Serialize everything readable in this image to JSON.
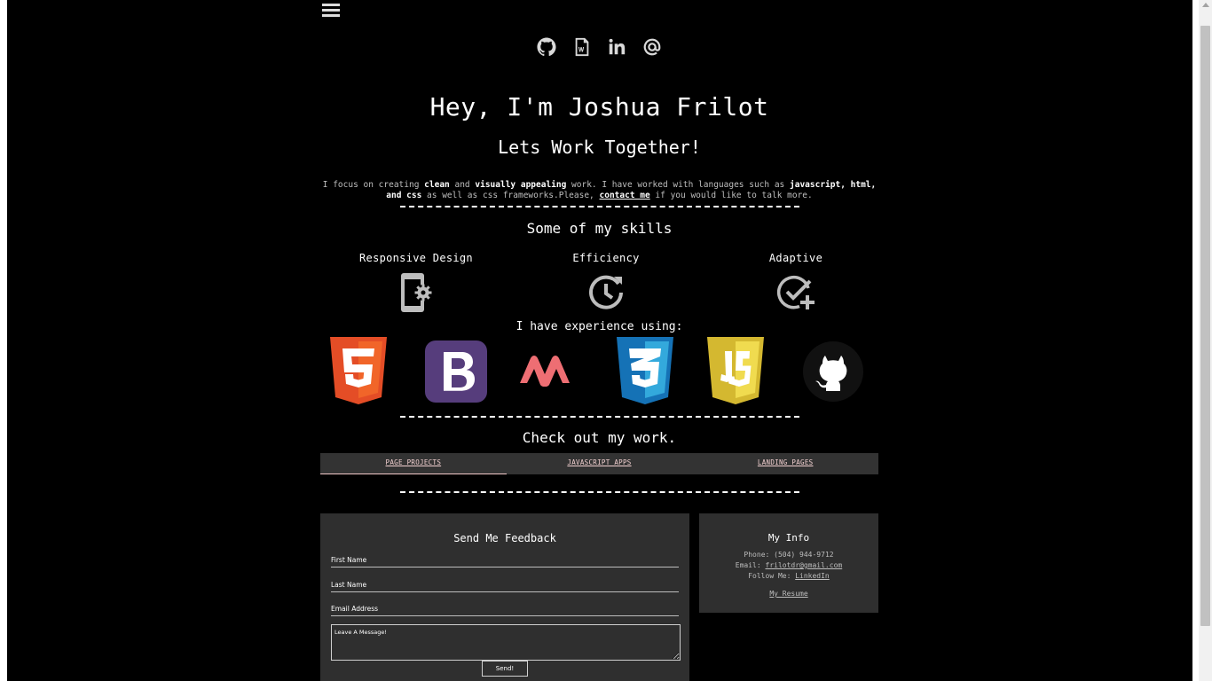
{
  "social": {
    "icons": [
      "github-icon",
      "resume-document-icon",
      "linkedin-icon",
      "email-at-icon"
    ]
  },
  "hero": {
    "title": "Hey, I'm Joshua Frilot",
    "subtitle": "Lets Work Together!"
  },
  "intro": {
    "t1": "I focus on creating ",
    "b1": "clean",
    "t2": " and ",
    "b2": "visually appealing",
    "t3": " work. I have worked with languages such as ",
    "b3": "javascript, html, and css",
    "t4": " as well as css frameworks.Please, ",
    "link": "contact me",
    "t5": " if you would like to talk more."
  },
  "skills": {
    "title": "Some of my skills",
    "items": [
      {
        "label": "Responsive Design",
        "icon": "phone-settings-icon"
      },
      {
        "label": "Efficiency",
        "icon": "clock-refresh-icon"
      },
      {
        "label": "Adaptive",
        "icon": "check-circle-plus-icon"
      }
    ]
  },
  "experience": {
    "title": "I have experience using:",
    "icons": [
      "html5-icon",
      "bootstrap-icon",
      "materialize-icon",
      "css3-icon",
      "javascript-icon",
      "github-octocat-icon"
    ],
    "colors": {
      "html5": "#e44d26",
      "bootstrap": "#563d7c",
      "materialize": "#ee6e73",
      "css3": "#1572b6",
      "javascript": "#f0db4f"
    }
  },
  "work": {
    "title": "Check out my work.",
    "tabs": [
      "PAGE PROJECTS",
      "JAVASCRIPT APPS",
      "LANDING PAGES"
    ]
  },
  "feedback": {
    "title": "Send Me Feedback",
    "first_name_placeholder": "First Name",
    "last_name_placeholder": "Last Name",
    "email_placeholder": "Email Address",
    "message_placeholder": "Leave A Message!",
    "send_label": "Send!"
  },
  "info": {
    "title": "My Info",
    "phone_label": "Phone: ",
    "phone": "(504) 944-9712",
    "email_label": "Email: ",
    "email": "frilotdr@gmail.com",
    "follow_label": "Follow Me: ",
    "linkedin": "LinkedIn",
    "resume": "My Resume"
  }
}
